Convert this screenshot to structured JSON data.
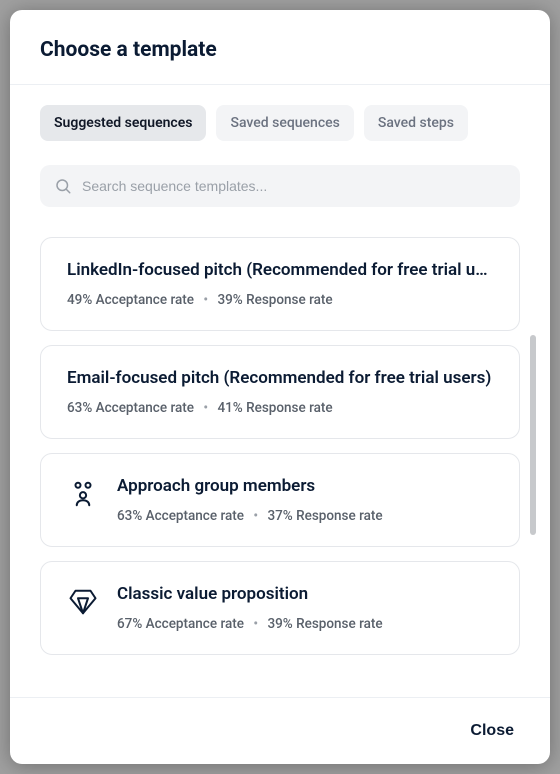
{
  "header": {
    "title": "Choose a template"
  },
  "tabs": [
    {
      "label": "Suggested sequences",
      "active": true
    },
    {
      "label": "Saved sequences",
      "active": false
    },
    {
      "label": "Saved steps",
      "active": false
    }
  ],
  "search": {
    "placeholder": "Search sequence templates..."
  },
  "templates": [
    {
      "title": "LinkedIn-focused pitch (Recommended for free trial users)",
      "acceptance": "49%",
      "response": "39%",
      "acceptance_label": "Acceptance rate",
      "response_label": "Response rate",
      "icon": null
    },
    {
      "title": "Email-focused pitch (Recommended for free trial users)",
      "acceptance": "63%",
      "response": "41%",
      "acceptance_label": "Acceptance rate",
      "response_label": "Response rate",
      "icon": null
    },
    {
      "title": "Approach group members",
      "acceptance": "63%",
      "response": "37%",
      "acceptance_label": "Acceptance rate",
      "response_label": "Response rate",
      "icon": "group-icon"
    },
    {
      "title": "Classic value proposition",
      "acceptance": "67%",
      "response": "39%",
      "acceptance_label": "Acceptance rate",
      "response_label": "Response rate",
      "icon": "diamond-icon"
    }
  ],
  "footer": {
    "close_label": "Close"
  }
}
